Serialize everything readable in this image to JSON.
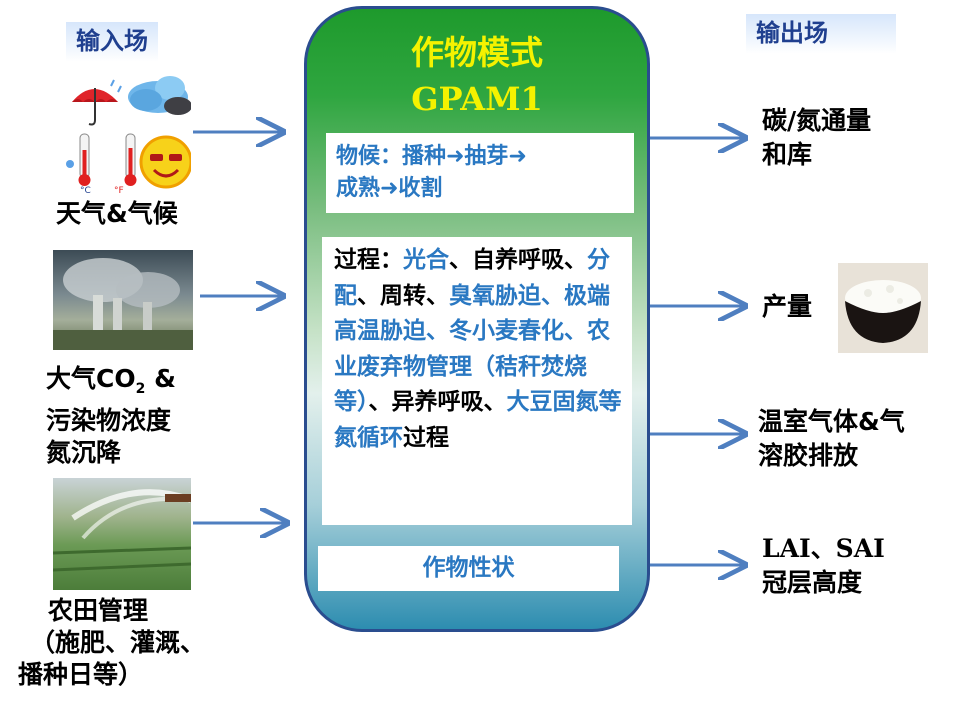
{
  "input_header": "输入场",
  "output_header": "输出场",
  "inputs": {
    "weather": {
      "label": "天气&气候"
    },
    "atmosphere": {
      "line1_a": "大气CO",
      "line1_sub": "2",
      "line1_b": " &",
      "line2": "污染物浓度",
      "line3": "氮沉降"
    },
    "farm": {
      "line1": "农田管理",
      "line2": "（施肥、灌溉、",
      "line3": "播种日等）"
    }
  },
  "model": {
    "title": "作物模式",
    "subtitle": "GPAM1",
    "phenology": {
      "line1": "物候：播种➜抽芽➜",
      "line2": "成熟➜收割"
    },
    "process": {
      "segments": [
        {
          "text": "过程：",
          "color": "black"
        },
        {
          "text": "光合",
          "color": "blue"
        },
        {
          "text": "、自养呼吸、",
          "color": "black"
        },
        {
          "text": "分配",
          "color": "blue"
        },
        {
          "text": "、周转、",
          "color": "black"
        },
        {
          "text": "臭氧胁迫、极端高温胁迫、冬小麦春化、农业废弃物管理（秸秆焚烧等）",
          "color": "blue"
        },
        {
          "text": "、异养呼吸、",
          "color": "black"
        },
        {
          "text": "大豆固氮等氮循环",
          "color": "blue"
        },
        {
          "text": "过程",
          "color": "black"
        }
      ]
    },
    "traits": "作物性状"
  },
  "outputs": {
    "carbon": {
      "line1": "碳/氮通量",
      "line2": "和库"
    },
    "yield": {
      "label": "产量"
    },
    "ghg": {
      "line1": "温室气体&气",
      "line2": "溶胶排放"
    },
    "lai": {
      "line1": "LAI、SAI",
      "line2": "冠层高度"
    }
  },
  "icons": [
    "umbrella-rain-icon",
    "cloud-icon",
    "thermometer-icon",
    "sun-face-icon",
    "smokestack-photo",
    "irrigation-photo",
    "rice-bowl-photo"
  ],
  "colors": {
    "arrow": "#4f7fc0",
    "model_border": "#2a4d8f",
    "title_yellow": "#f5f200",
    "blue_text": "#2a78c2",
    "header_text": "#1f3f8f"
  }
}
